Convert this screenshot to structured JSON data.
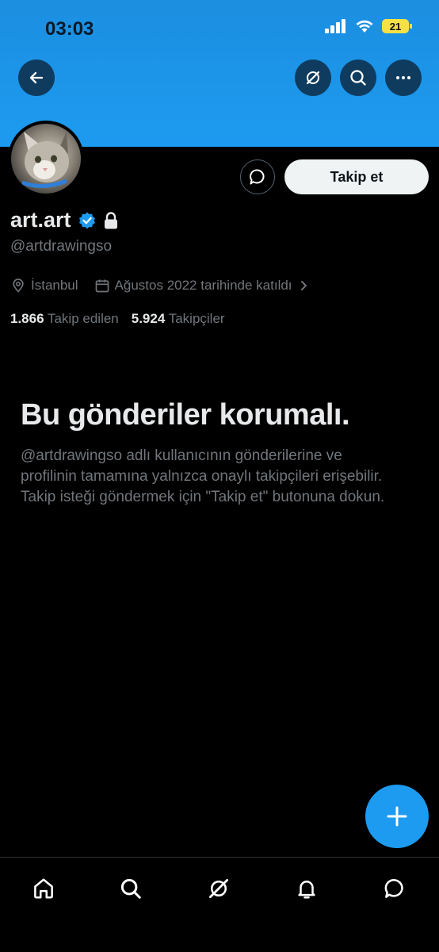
{
  "status_bar": {
    "time": "03:03",
    "battery": "21"
  },
  "profile": {
    "display_name": "art.art",
    "handle": "@artdrawingso",
    "location": "İstanbul",
    "joined": "Ağustos 2022 tarihinde katıldı",
    "following_count": "1.866",
    "following_label": "Takip edilen",
    "followers_count": "5.924",
    "followers_label": "Takipçiler"
  },
  "actions": {
    "follow_label": "Takip et"
  },
  "protected": {
    "title": "Bu gönderiler korumalı.",
    "body": "@artdrawingso adlı kullanıcının gönderilerine ve profilinin tamamına yalnızca onaylı takipçileri erişebilir. Takip isteği göndermek için \"Takip et\" butonuna dokun."
  },
  "colors": {
    "accent": "#1d9bf0",
    "background": "#000000",
    "secondary_text": "#71767b"
  },
  "icons": {
    "top_bar": [
      "back-arrow-icon",
      "grok-icon",
      "search-icon",
      "more-icon"
    ],
    "tab_bar": [
      "home-icon",
      "search-icon",
      "grok-icon",
      "notifications-icon",
      "messages-icon"
    ]
  }
}
